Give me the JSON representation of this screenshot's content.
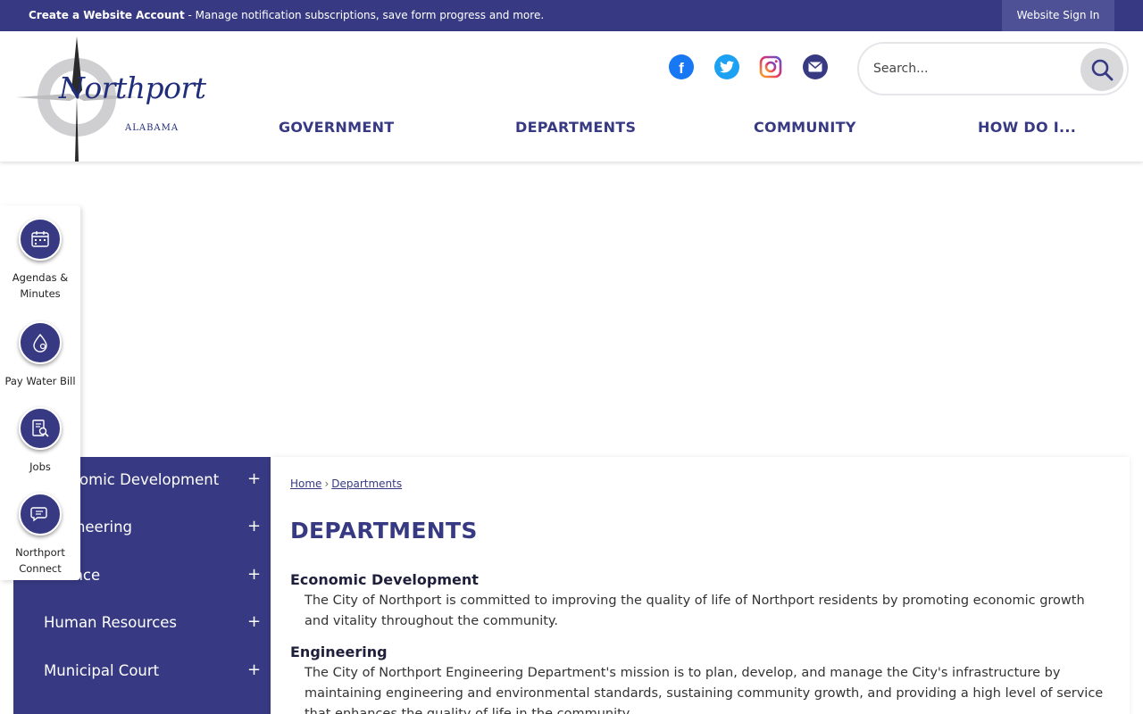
{
  "topbar": {
    "create_account_label": "Create a Website Account",
    "create_account_desc": " - Manage notification subscriptions, save form progress and more.",
    "sign_in_label": "Website Sign In"
  },
  "logo": {
    "name": "Northport",
    "state": "ALABAMA"
  },
  "social": [
    {
      "icon": "facebook-icon",
      "color": "#1877f2"
    },
    {
      "icon": "twitter-icon",
      "color": "#1da1f2"
    },
    {
      "icon": "instagram-icon",
      "color": "#c13584"
    },
    {
      "icon": "email-icon",
      "color": "#373a83"
    }
  ],
  "search": {
    "placeholder": "Search..."
  },
  "nav": [
    "GOVERNMENT",
    "DEPARTMENTS",
    "COMMUNITY",
    "HOW DO I..."
  ],
  "quick_links": [
    {
      "label": "Agendas & Minutes",
      "icon": "calendar-icon"
    },
    {
      "label": "Pay Water Bill",
      "icon": "water-drop-icon"
    },
    {
      "label": "Jobs",
      "icon": "document-search-icon"
    },
    {
      "label": "Northport Connect",
      "icon": "chat-icon"
    }
  ],
  "sidenav": [
    {
      "label": "Economic Development",
      "toggle": "+"
    },
    {
      "label": "Engineering",
      "toggle": "+"
    },
    {
      "label": "Finance",
      "toggle": "+"
    },
    {
      "label": "Human Resources",
      "toggle": "+"
    },
    {
      "label": "Municipal Court",
      "toggle": "+"
    }
  ],
  "breadcrumb": {
    "home": "Home",
    "separator": "›",
    "current": "Departments"
  },
  "page_title": "DEPARTMENTS",
  "departments": [
    {
      "name": "Economic Development",
      "description": "The City of Northport is committed to improving the quality of life of Northport residents by promoting economic growth and vitality throughout the community."
    },
    {
      "name": "Engineering",
      "description": "The City of Northport Engineering Department's mission is to plan, develop, and manage the City's infrastructure by maintaining engineering and environmental standards, sustaining community growth, and providing a high level of service that enhances the quality of life in the community."
    }
  ],
  "colors": {
    "brand": "#373a83",
    "header_bg": "#ffffff",
    "search_btn": "#d9d9dc"
  }
}
